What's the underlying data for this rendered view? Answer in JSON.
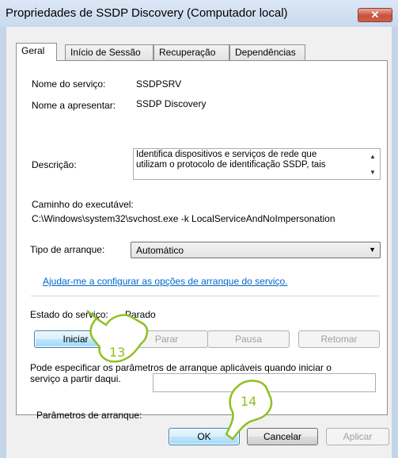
{
  "window": {
    "title": "Propriedades de SSDP Discovery (Computador local)",
    "close_glyph": "✕"
  },
  "tabs": [
    "Geral",
    "Início de Sessão",
    "Recuperação",
    "Dependências"
  ],
  "general": {
    "service_name_label": "Nome do serviço:",
    "service_name_value": "SSDPSRV",
    "display_name_label": "Nome a apresentar:",
    "display_name_value": "SSDP Discovery",
    "description_label": "Descrição:",
    "description_line1": "Identifica dispositivos e serviços de rede que",
    "description_line2": "utilizam o protocolo de identificação SSDP, tais",
    "path_label": "Caminho do executável:",
    "path_value": "C:\\Windows\\system32\\svchost.exe -k LocalServiceAndNoImpersonation",
    "startup_type_label": "Tipo de arranque:",
    "startup_type_value": "Automático",
    "help_link": "Ajudar-me a configurar as opções de arranque do serviço.",
    "status_label": "Estado do serviço:",
    "status_value": "Parado",
    "start_button": "Iniciar",
    "stop_button": "Parar",
    "pause_button": "Pausa",
    "resume_button": "Retomar",
    "params_info_part1": "Pode especificar os parâmetros de arranque aplicáveis quando iniciar o",
    "params_info_part2": "serviço a partir daqui.",
    "params_label": "Parâmetros de arranque:",
    "params_value": ""
  },
  "footer": {
    "ok_button": "OK",
    "cancel_button": "Cancelar",
    "apply_button": "Aplicar"
  },
  "annotations": {
    "step_a": "13",
    "step_b": "14",
    "color": "#8fbf1f"
  }
}
